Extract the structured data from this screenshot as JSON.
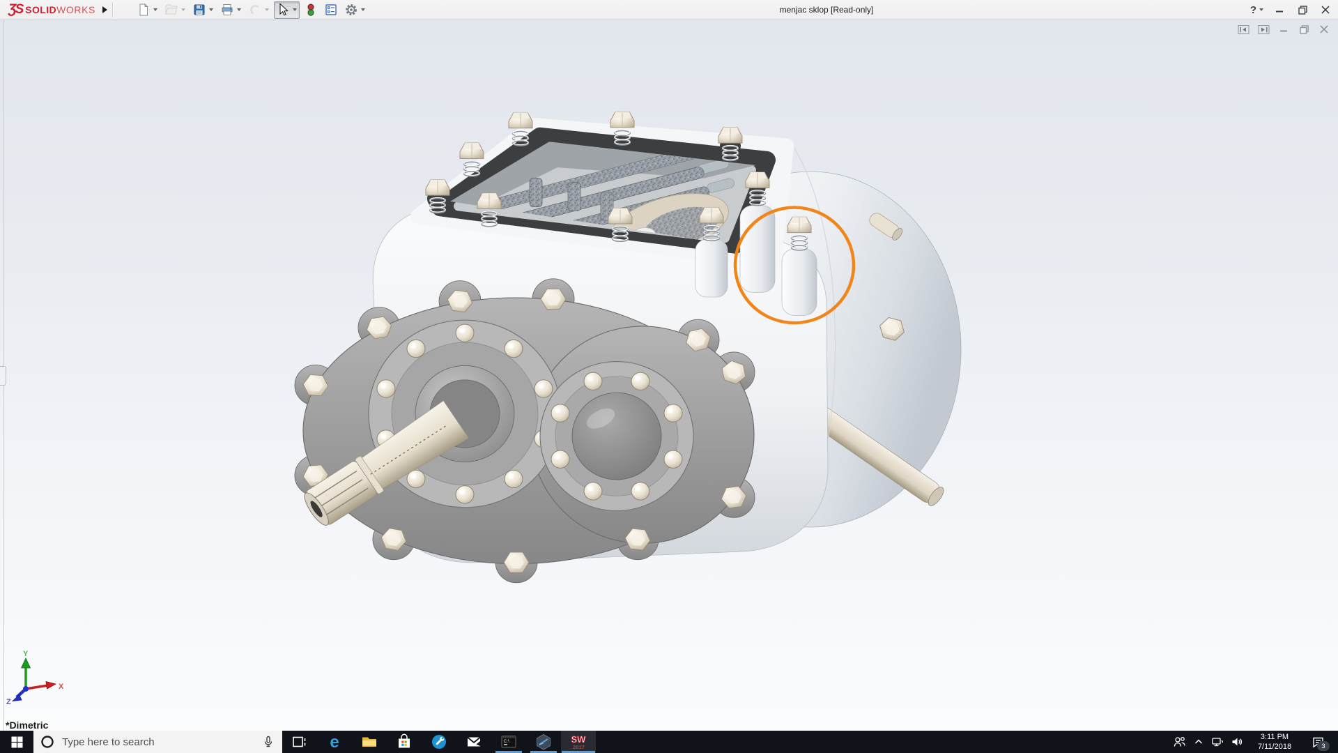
{
  "colors": {
    "brand_red": "#CF2030",
    "accent_orange": "#F08519",
    "taskbar_underline_blue": "#5C9FD8",
    "gasket_dark": "#3C3E40",
    "housing_white": "#F4F6F8",
    "plate_gray": "#9B9B9B"
  },
  "titlebar": {
    "brand": {
      "glyph": "ƷS",
      "bold": "SOLID",
      "light": "WORKS"
    },
    "title": "menjac sklop [Read-only]",
    "help_label": "?",
    "toolbar": [
      {
        "name": "new-document",
        "caret": true
      },
      {
        "name": "open-folder",
        "caret": true,
        "disabled": true
      },
      {
        "name": "save",
        "caret": true
      },
      {
        "name": "print",
        "caret": true
      },
      {
        "name": "undo",
        "caret": true,
        "disabled": true
      },
      {
        "name": "select-cursor",
        "caret": true,
        "pressed": true
      },
      {
        "name": "rebuild-traffic-light",
        "caret": false
      },
      {
        "name": "report-table",
        "caret": false
      },
      {
        "name": "options-gear",
        "caret": true
      }
    ],
    "window_control_icons": [
      "help",
      "minimize",
      "restore",
      "close"
    ]
  },
  "child_window": {
    "control_icons": [
      "pane-previous",
      "pane-next",
      "minimize",
      "restore",
      "close"
    ]
  },
  "viewport": {
    "view_orientation_label": "*Dimetric",
    "axis_labels": {
      "x": "X",
      "y": "Y",
      "z": "Z"
    },
    "annotation": {
      "shape": "circle",
      "color": "#F08519"
    }
  },
  "taskbar": {
    "search_placeholder": "Type here to search",
    "start_icon": "windows-logo",
    "search_icons": [
      "cortana-circle",
      "microphone"
    ],
    "apps": [
      {
        "name": "task-view"
      },
      {
        "name": "edge"
      },
      {
        "name": "file-explorer"
      },
      {
        "name": "store"
      },
      {
        "name": "get-help"
      },
      {
        "name": "mail"
      },
      {
        "name": "command-prompt",
        "label": "C:\\",
        "running": true
      },
      {
        "name": "solidworks-rx",
        "running": true
      },
      {
        "name": "solidworks-2017",
        "year": "2017",
        "running": true,
        "active": true
      }
    ],
    "tray_icons": [
      "people",
      "chevron-up",
      "network",
      "volume",
      "action-center",
      "show-desktop"
    ],
    "clock": {
      "time": "3:11 PM",
      "date": "7/11/2018"
    },
    "notification_count": "3"
  }
}
